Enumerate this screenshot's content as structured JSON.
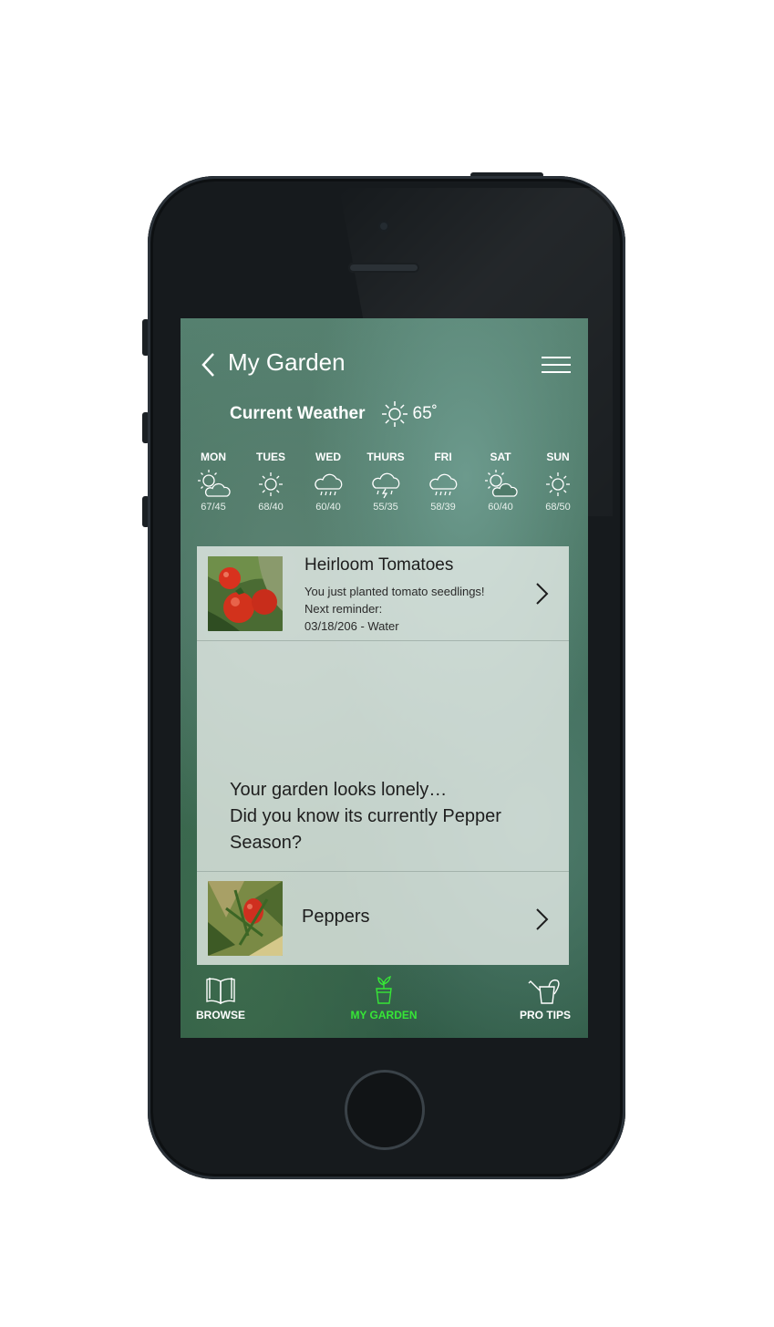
{
  "header": {
    "title": "My Garden"
  },
  "weather": {
    "label": "Current Weather",
    "temp": "65˚",
    "icon": "sun-icon"
  },
  "forecast": [
    {
      "day": "MON",
      "temps": "67/45",
      "icon": "partly-cloudy-icon"
    },
    {
      "day": "TUES",
      "temps": "68/40",
      "icon": "sun-icon"
    },
    {
      "day": "WED",
      "temps": "60/40",
      "icon": "rain-cloud-icon"
    },
    {
      "day": "THURS",
      "temps": "55/35",
      "icon": "thunderstorm-icon"
    },
    {
      "day": "FRI",
      "temps": "58/39",
      "icon": "rain-cloud-icon"
    },
    {
      "day": "SAT",
      "temps": "60/40",
      "icon": "partly-cloudy-icon"
    },
    {
      "day": "SUN",
      "temps": "68/50",
      "icon": "sun-icon"
    }
  ],
  "plants": [
    {
      "title": "Heirloom Tomatoes",
      "line1": "You just planted tomato seedlings!",
      "line2": "Next reminder:",
      "line3": "03/18/206 - Water"
    },
    {
      "title": "Peppers"
    }
  ],
  "lonely": {
    "line1": "Your garden looks lonely…",
    "line2": "Did you know its currently Pepper",
    "line3": "Season?"
  },
  "tabs": {
    "browse": "BROWSE",
    "garden": "MY GARDEN",
    "tips": "PRO TIPS"
  },
  "colors": {
    "active_tab": "#36e636",
    "panel": "#ebf0ec"
  }
}
